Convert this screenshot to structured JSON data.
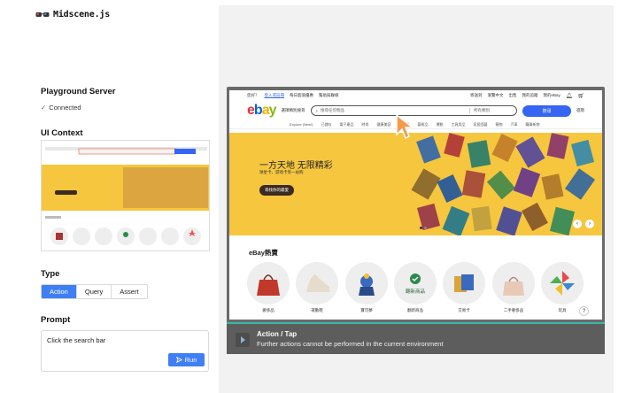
{
  "app": {
    "name": "Midscene.js"
  },
  "sidebar": {
    "server_title": "Playground Server",
    "server_status": "Connected",
    "context_title": "UI Context",
    "type_title": "Type",
    "type_tabs": [
      "Action",
      "Query",
      "Assert"
    ],
    "active_type": "Action",
    "prompt_title": "Prompt",
    "prompt_value": "Click the search bar",
    "run_label": "Run"
  },
  "ebay": {
    "logo": "ebay",
    "categories_dropdown": "選擇類別搜尋",
    "search_placeholder": "搜尋任何物品",
    "all_categories": "所有類別",
    "search_button": "搜尋",
    "advanced": "進階",
    "top_left": [
      "您好！",
      "登入或註冊",
      "每日超值優惠",
      "幫助與聯絡"
    ],
    "top_right": [
      "寄送到",
      "瀏覽中文",
      "出售",
      "我的追蹤",
      "我的eBay"
    ],
    "nav": [
      "Explore (New!)",
      "已儲存",
      "電子產品",
      "時尚",
      "健康美容",
      "收藏品",
      "藝術品",
      "運動",
      "工具用品",
      "家居園藝",
      "寵物",
      "汽車",
      "購買新物"
    ],
    "banner_title": "一方天地 无限精彩",
    "banner_subtitle": "球星卡、游戏卡等一站购",
    "banner_button": "尋找你的最愛",
    "hot_title": "eBay熱賣",
    "categories": [
      "奢侈品",
      "運動鞋",
      "寶可夢",
      "翻新商品",
      "交易卡",
      "二手奢侈品",
      "玩具"
    ],
    "refurbished_text": "翻新商品",
    "help": "?"
  },
  "action_bar": {
    "title": "Action / Tap",
    "description": "Further actions cannot be performed in the current environment"
  },
  "colors": {
    "accent": "#3f7ff5",
    "ebay_blue": "#3665f3",
    "banner_yellow": "#f6c63e",
    "status_teal": "#35b7a6",
    "cursor_orange": "#f39c4a"
  }
}
